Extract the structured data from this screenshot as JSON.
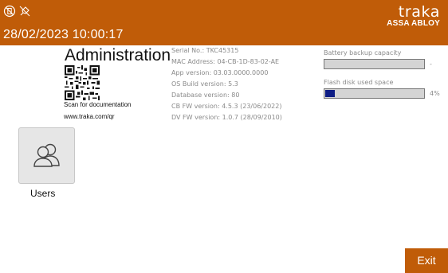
{
  "header": {
    "status_icons": [
      "battery-off-icon",
      "power-unplugged-icon"
    ],
    "datetime": "28/02/2023 10:00:17",
    "brand_mark": "traka",
    "brand_sub": "ASSA ABLOY"
  },
  "admin": {
    "title": "Administration",
    "scan_label": "Scan for documentation",
    "scan_url": "www.traka.com/qr"
  },
  "info": {
    "serial": "Serial No.: TKC45315",
    "mac": "MAC Address: 04-CB-1D-83-02-AE",
    "app_version": "App version:  03.03.0000.0000",
    "os_build": "OS Build version:  5.3",
    "db_version": "Database version:  80",
    "cb_fw": "CB FW version: 4.5.3 (23/06/2022)",
    "dv_fw": "DV FW version: 1.0.7 (28/09/2010)"
  },
  "battery": {
    "label": "Battery backup capacity",
    "value_text": "-"
  },
  "flash": {
    "label": "Flash disk used space",
    "percent": 4,
    "value_text": "4%"
  },
  "users": {
    "label": "Users",
    "icon": "users-icon"
  },
  "exit": {
    "label": "Exit"
  },
  "colors": {
    "accent": "#c05c08",
    "meter_fill": "#0e1d85"
  }
}
